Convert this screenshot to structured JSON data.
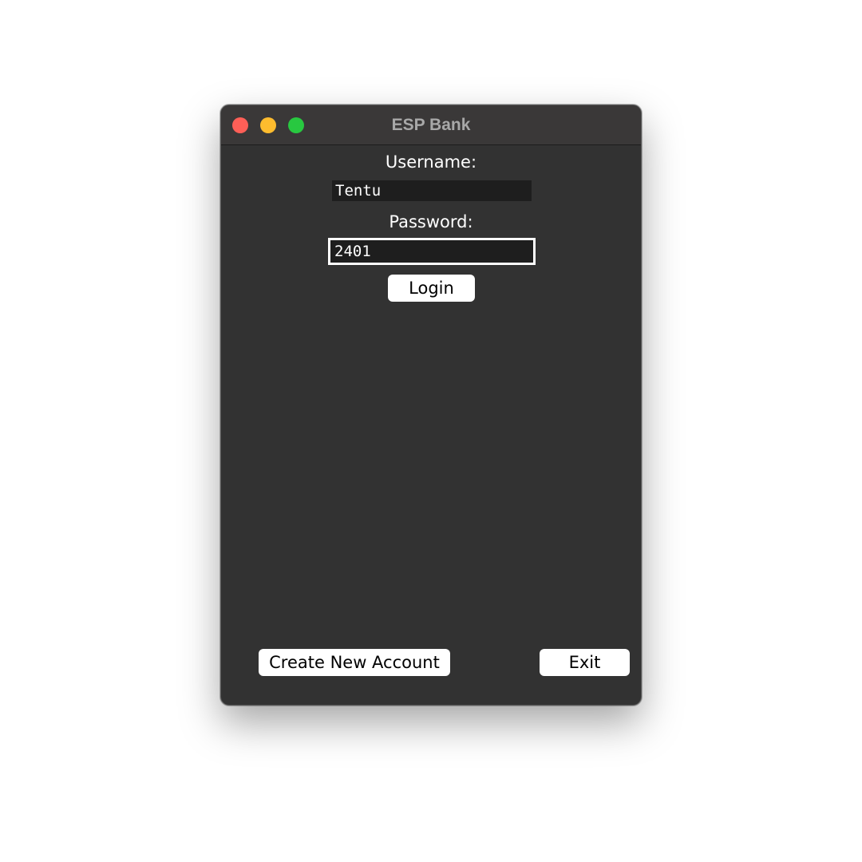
{
  "window": {
    "title": "ESP Bank"
  },
  "form": {
    "username_label": "Username:",
    "username_value": "Tentu",
    "password_label": "Password:",
    "password_value": "2401",
    "login_label": "Login"
  },
  "footer": {
    "create_account_label": "Create New Account",
    "exit_label": "Exit"
  },
  "colors": {
    "window_bg": "#323232",
    "field_bg": "#1e1e1e",
    "traffic_close": "#fe5f57",
    "traffic_minimize": "#febc2e",
    "traffic_zoom": "#28c840"
  }
}
